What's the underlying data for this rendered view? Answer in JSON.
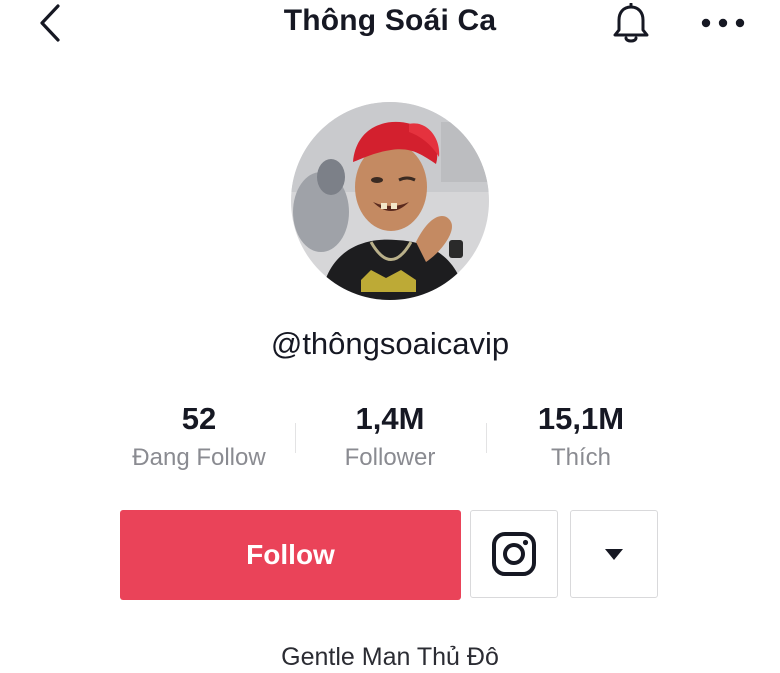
{
  "header": {
    "title": "Thông Soái Ca",
    "back_icon": "chevron-left-icon",
    "bell_icon": "bell-icon",
    "more_icon": "more-horizontal-icon"
  },
  "profile": {
    "username": "@thôngsoaicavip",
    "avatar_icon": "profile-photo"
  },
  "stats": [
    {
      "value": "52",
      "label": "Đang Follow"
    },
    {
      "value": "1,4M",
      "label": "Follower"
    },
    {
      "value": "15,1M",
      "label": "Thích"
    }
  ],
  "actions": {
    "follow_label": "Follow",
    "follow_color": "#ea4359",
    "instagram_icon": "instagram-icon",
    "dropdown_icon": "caret-down-icon"
  },
  "bio": "Gentle Man Thủ Đô"
}
